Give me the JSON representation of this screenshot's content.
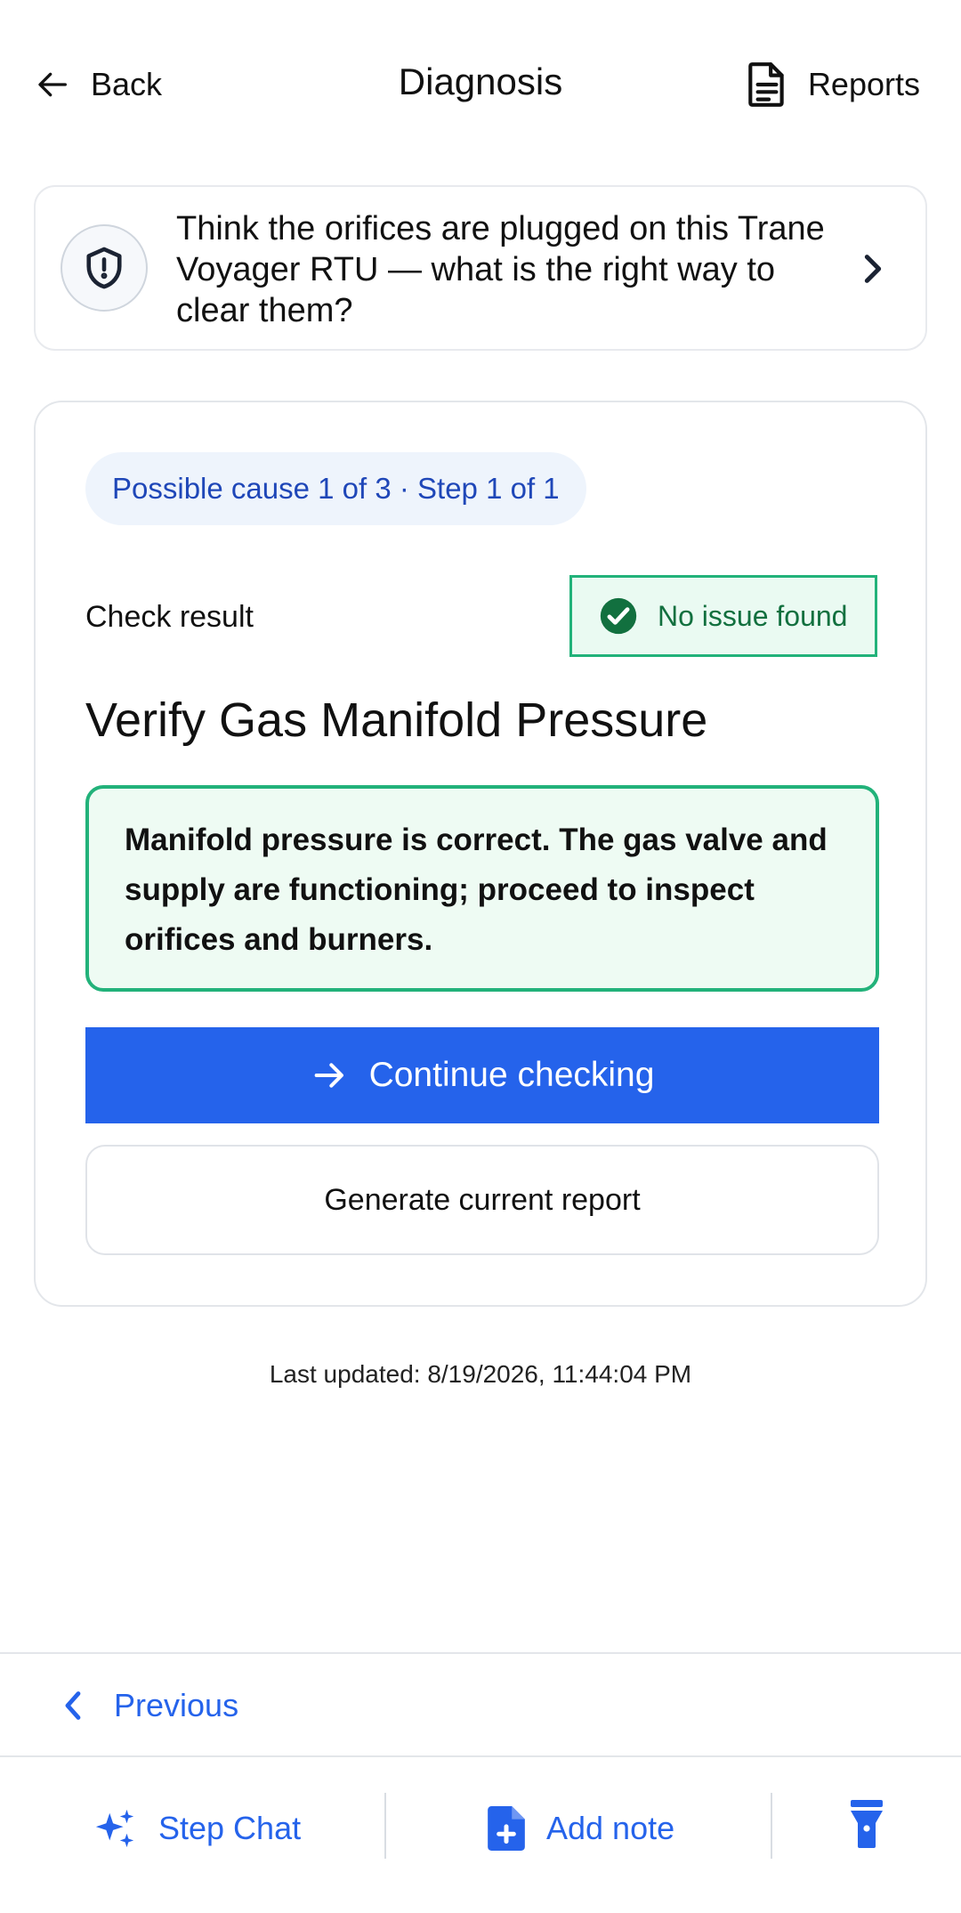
{
  "header": {
    "back_label": "Back",
    "title": "Diagnosis",
    "reports_label": "Reports"
  },
  "question": {
    "text": "Think the orifices are plugged on this Trane Voyager RTU — what is the right way to clear them?"
  },
  "card": {
    "step_pill": "Possible cause 1 of 3 · Step 1 of 1",
    "check_label": "Check result",
    "result_badge": "No issue found",
    "check_title": "Verify Gas Manifold Pressure",
    "result_text": "Manifold pressure is correct. The gas valve and supply are functioning; proceed to inspect orifices and burners.",
    "continue_label": "Continue checking",
    "report_label": "Generate current report"
  },
  "footer": {
    "last_updated": "Last updated: 8/19/2026, 11:44:04 PM",
    "previous_label": "Previous"
  },
  "actions": {
    "step_chat_label": "Step Chat",
    "add_note_label": "Add note"
  },
  "colors": {
    "accent": "#2563eb",
    "success": "#22b27a",
    "pill_bg": "#eef4fc"
  },
  "icons": {
    "back": "arrow-left-icon",
    "reports": "document-icon",
    "question": "shield-alert-icon",
    "question_open": "chevron-right-icon",
    "result": "check-circle-icon",
    "continue": "arrow-right-icon",
    "previous": "chevron-left-icon",
    "step_chat": "sparkles-icon",
    "add_note": "file-plus-icon",
    "flashlight": "flashlight-icon"
  }
}
